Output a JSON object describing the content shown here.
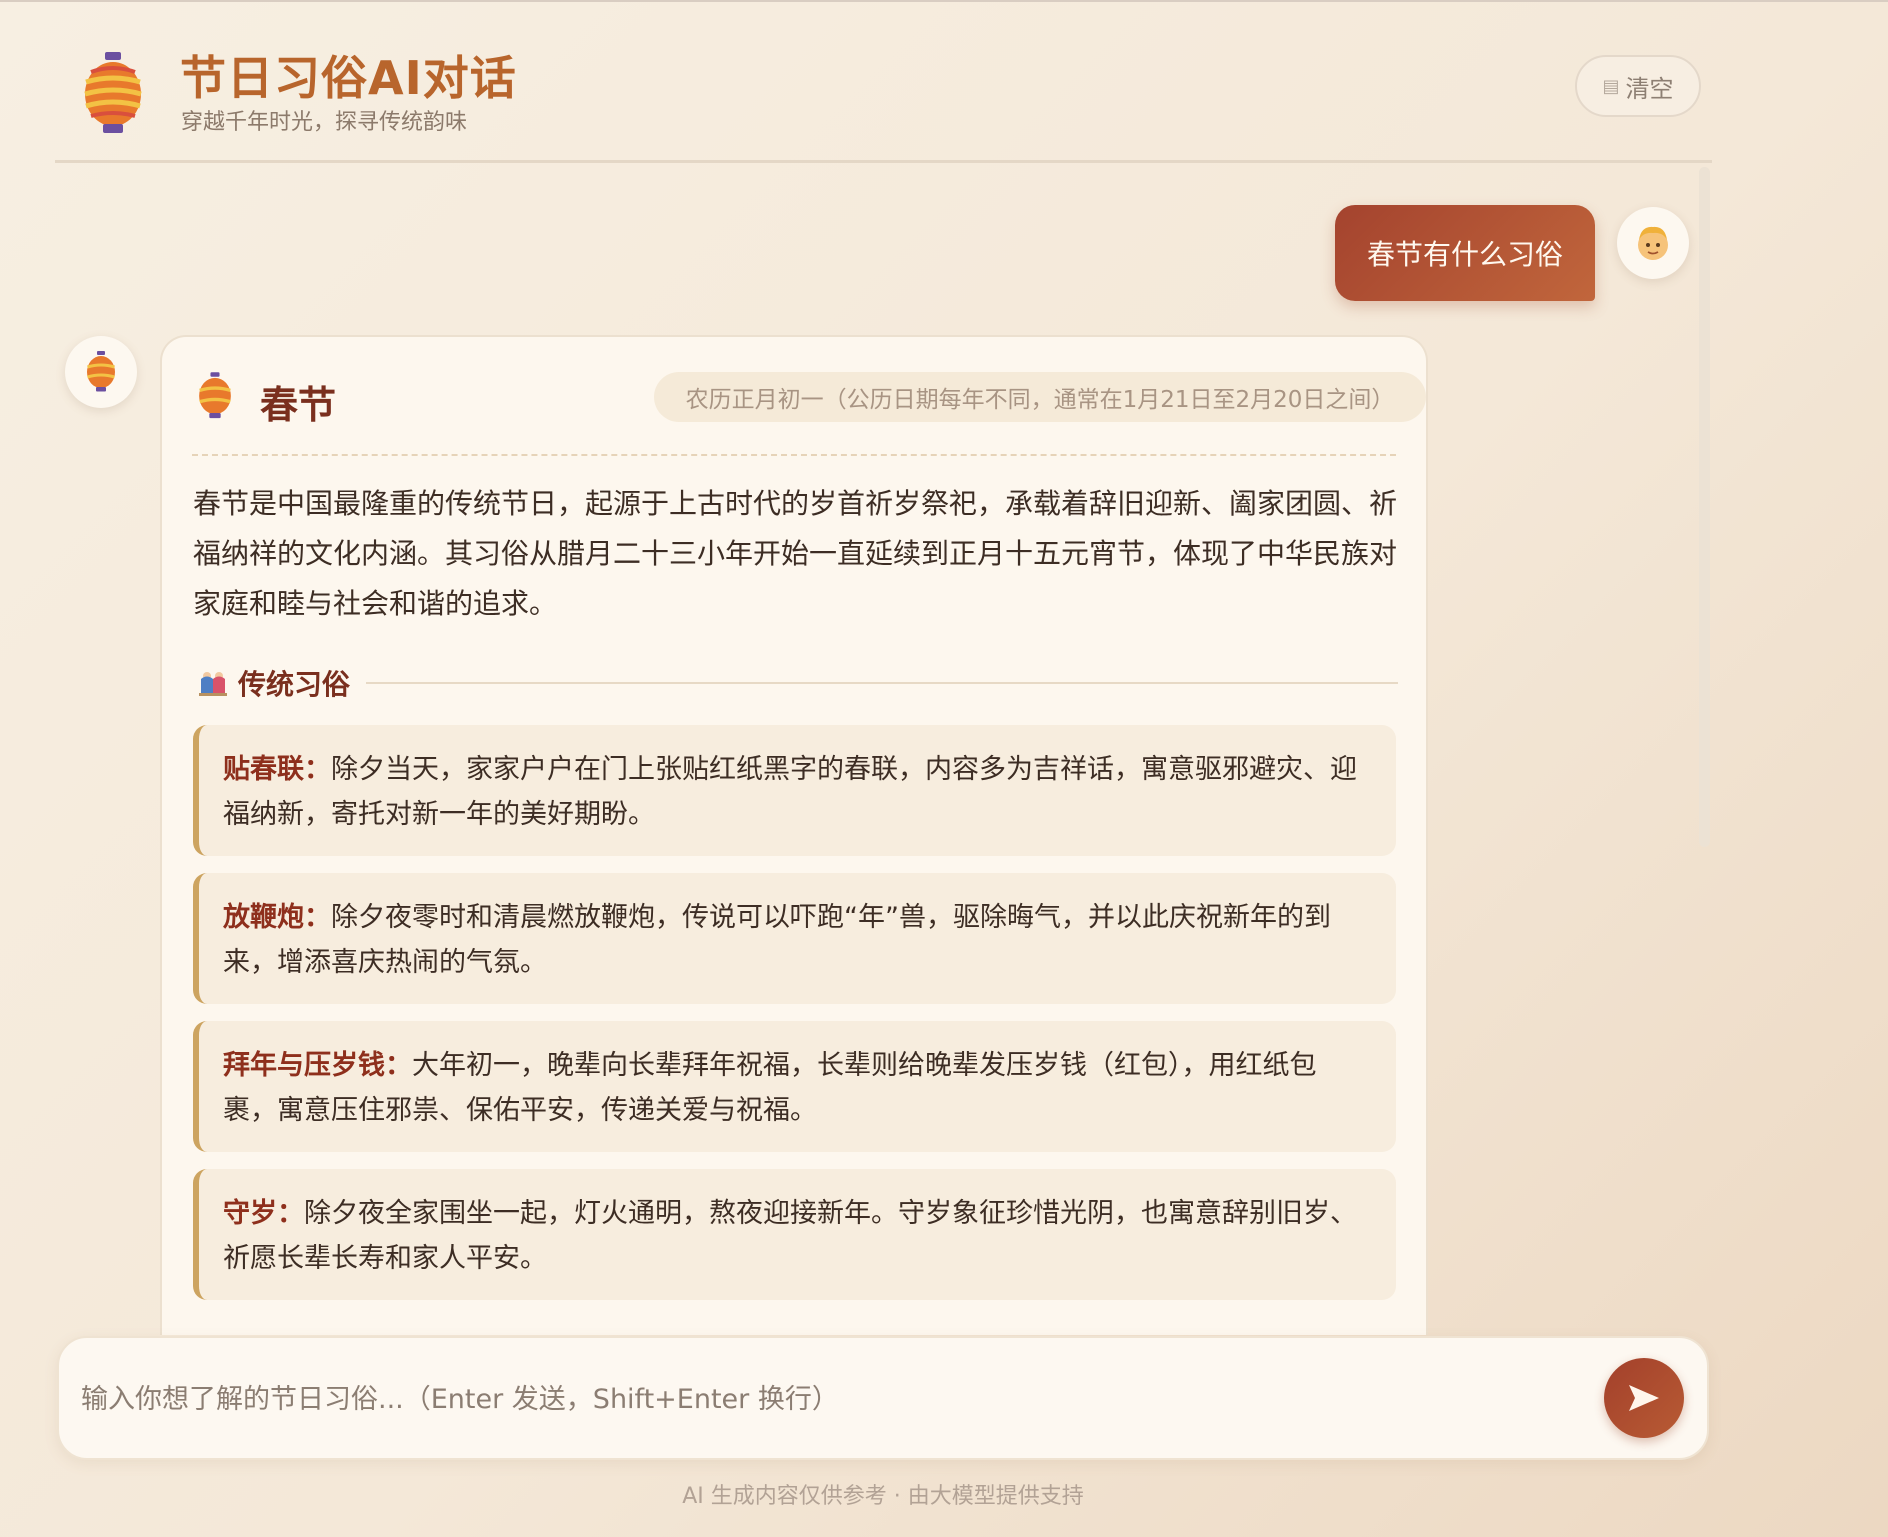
{
  "app": {
    "title": "节日习俗AI对话",
    "subtitle": "穿越千年时光，探寻传统韵味",
    "clear_label": "清空",
    "clear_icon": "trash-icon"
  },
  "conversation": {
    "user_message": "春节有什么习俗",
    "user_avatar_icon": "person-face-icon",
    "bot_avatar_icon": "lantern-icon",
    "answer": {
      "festival": "春节",
      "date": "农历正月初一（公历日期每年不同，通常在1月21日至2月20日之间）",
      "intro": "春节是中国最隆重的传统节日，起源于上古时代的岁首祈岁祭祀，承载着辞旧迎新、阖家团圆、祈福纳祥的文化内涵。其习俗从腊月二十三小年开始一直延续到正月十五元宵节，体现了中华民族对家庭和睦与社会和谐的追求。",
      "section_title": "传统习俗",
      "customs": [
        {
          "name": "贴春联：",
          "text": "除夕当天，家家户户在门上张贴红纸黑字的春联，内容多为吉祥话，寓意驱邪避灾、迎福纳新，寄托对新一年的美好期盼。"
        },
        {
          "name": "放鞭炮：",
          "text": "除夕夜零时和清晨燃放鞭炮，传说可以吓跑“年”兽，驱除晦气，并以此庆祝新年的到来，增添喜庆热闹的气氛。"
        },
        {
          "name": "拜年与压岁钱：",
          "text": "大年初一，晚辈向长辈拜年祝福，长辈则给晚辈发压岁钱（红包），用红纸包裹，寓意压住邪祟、保佑平安，传递关爱与祝福。"
        },
        {
          "name": "守岁：",
          "text": "除夕夜全家围坐一起，灯火通明，熬夜迎接新年。守岁象征珍惜光阴，也寓意辞别旧岁、祈愿长辈长寿和家人平安。"
        }
      ]
    }
  },
  "input": {
    "placeholder": "输入你想了解的节日习俗...（Enter 发送，Shift+Enter 换行）",
    "value": "",
    "send_icon": "send-icon"
  },
  "footer": "AI 生成内容仅供参考 · 由大模型提供支持",
  "colors": {
    "accent": "#a3402b",
    "title": "#b8652c",
    "heading": "#7a2f1e",
    "custom_border": "#cda460",
    "background": "#f6ede0"
  }
}
